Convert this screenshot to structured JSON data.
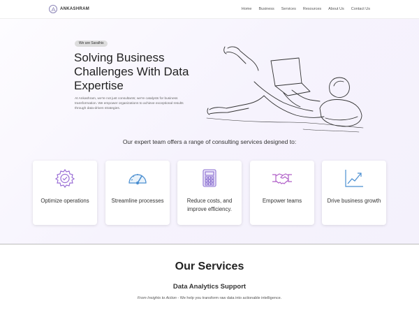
{
  "brand": {
    "name": "ANKASHRAM",
    "icon": "logo-icon"
  },
  "nav": {
    "items": [
      "Home",
      "Business",
      "Services",
      "Resources",
      "About Us",
      "Contact Us"
    ]
  },
  "hero": {
    "pill": "We are Saralhis",
    "title": "Solving Business Challenges With Data Expertise",
    "description": "At Ankashram, we're not just consultants; we're catalysts for business transformation. We empower organizations to achieve exceptional results through data-driven strategies.",
    "illustration": "person-lying-with-laptop-illustration"
  },
  "intro": {
    "text": "Our expert team offers a range of consulting services designed to:"
  },
  "cards": [
    {
      "label": "Optimize operations",
      "icon": "gear-check-icon",
      "color": "#9b6fd6"
    },
    {
      "label": "Streamline processes",
      "icon": "speedometer-icon",
      "color": "#4b8fd1"
    },
    {
      "label": "Reduce costs, and improve efficiency.",
      "icon": "calculator-icon",
      "color": "#8a6fd0"
    },
    {
      "label": "Empower teams",
      "icon": "handshake-icon",
      "color": "#b05fc8"
    },
    {
      "label": "Drive business growth",
      "icon": "growth-chart-icon",
      "color": "#4b8fd1"
    }
  ],
  "services": {
    "title": "Our Services",
    "subtitle": "Data Analytics Support",
    "tagline": "From Insights to Action",
    "description": " - We help you transform raw data into actionable intelligence."
  }
}
